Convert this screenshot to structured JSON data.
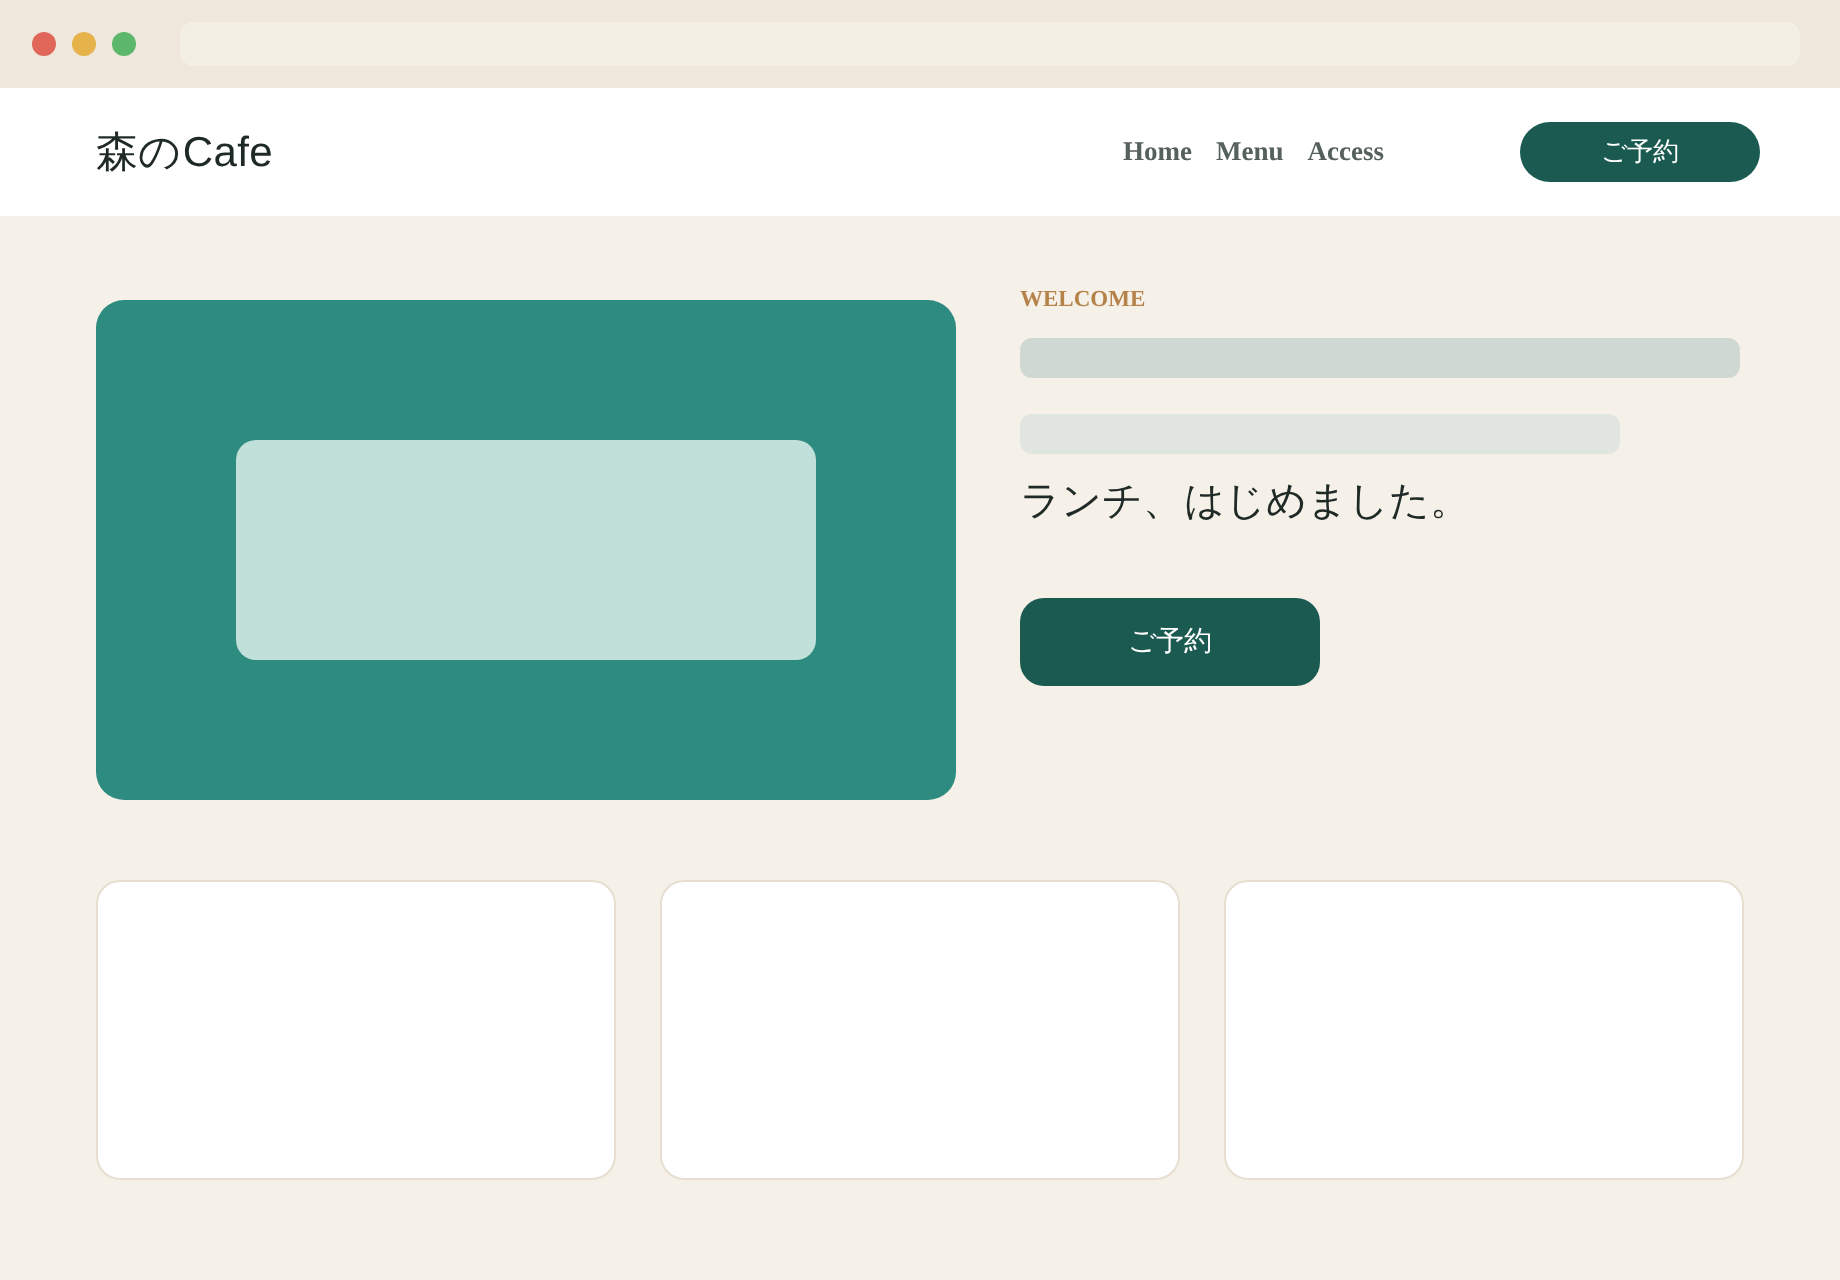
{
  "header": {
    "logo": "森のCafe",
    "nav": [
      {
        "label": "Home"
      },
      {
        "label": "Menu"
      },
      {
        "label": "Access"
      }
    ],
    "button": "ご予約"
  },
  "hero": {
    "eyebrow": "WELCOME",
    "headline": "ランチ、はじめました。",
    "button": "ご予約"
  }
}
